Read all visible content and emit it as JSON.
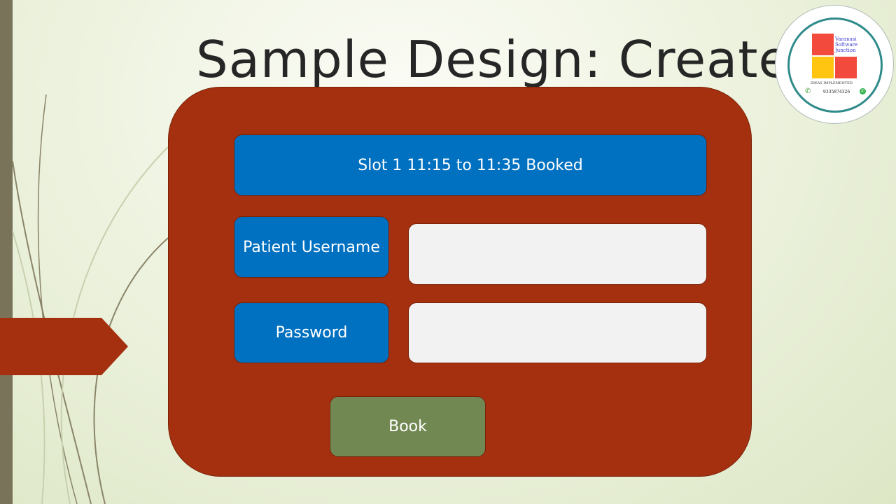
{
  "slide": {
    "title": "Sample Design: Create"
  },
  "logo": {
    "name_line1": "Varanasi",
    "name_line2": "Software",
    "name_line3": "Junction",
    "tagline": "IDEAS IMPLEMENTED",
    "phone": "9335874326",
    "call_icon": "phone-icon",
    "chat_icon": "whatsapp-icon",
    "colors": {
      "red": "#f24a3d",
      "yellow": "#ffc510",
      "ring": "#2f8a8a"
    }
  },
  "form": {
    "slot_label": "Slot 1 11:15 to 11:35 Booked",
    "username_label": "Patient Username",
    "username_value": "",
    "password_label": "Password",
    "password_value": "",
    "book_label": "Book"
  },
  "colors": {
    "panel": "#a5300f",
    "button_blue": "#0070c0",
    "book_green": "#718852",
    "field": "#f2f2f2"
  }
}
